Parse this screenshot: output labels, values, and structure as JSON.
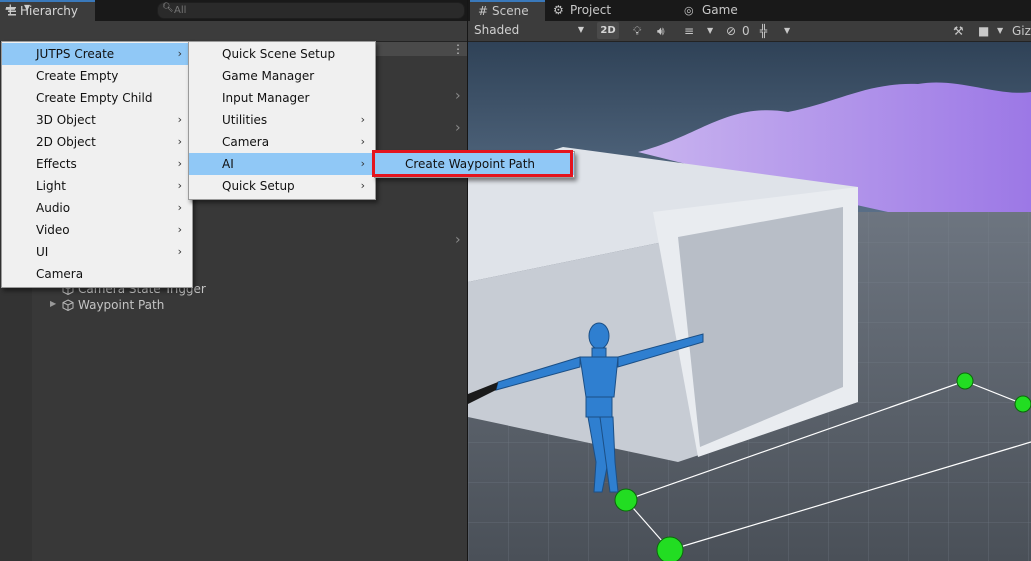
{
  "hierarchy": {
    "tab_title": "Hierarchy",
    "add_label": "+",
    "search_placeholder": "All",
    "tree_items": [
      {
        "label": "Camera State Trigger",
        "expandable": false
      },
      {
        "label": "Waypoint Path",
        "expandable": true
      }
    ]
  },
  "scene": {
    "tabs": [
      "Scene",
      "Project Settings",
      "Game"
    ],
    "shading_mode": "Shaded",
    "toggle_2d": "2D",
    "hidden_count": "0",
    "gizmos_label": "Giz"
  },
  "menus": {
    "main": [
      {
        "label": "JUTPS Create",
        "submenu": true,
        "highlighted": true
      },
      {
        "label": "Create Empty",
        "submenu": false
      },
      {
        "label": "Create Empty Child",
        "submenu": false
      },
      {
        "label": "3D Object",
        "submenu": true
      },
      {
        "label": "2D Object",
        "submenu": true
      },
      {
        "label": "Effects",
        "submenu": true
      },
      {
        "label": "Light",
        "submenu": true
      },
      {
        "label": "Audio",
        "submenu": true
      },
      {
        "label": "Video",
        "submenu": true
      },
      {
        "label": "UI",
        "submenu": true
      },
      {
        "label": "Camera",
        "submenu": false
      }
    ],
    "jutps": [
      {
        "label": "Quick Scene Setup",
        "submenu": false
      },
      {
        "label": "Game Manager",
        "submenu": false
      },
      {
        "label": "Input Manager",
        "submenu": false
      },
      {
        "label": "Utilities",
        "submenu": true
      },
      {
        "label": "Camera",
        "submenu": true
      },
      {
        "label": "AI",
        "submenu": true,
        "highlighted": true
      },
      {
        "label": "Quick Setup",
        "submenu": true
      }
    ],
    "ai": [
      {
        "label": "Create Waypoint Path",
        "submenu": false,
        "highlighted": true
      }
    ]
  },
  "colors": {
    "accent_tab": "#3a79bb",
    "menu_highlight": "#90c8f6",
    "callout_border": "#e4141e",
    "waypoint_gizmo": "#22dd22"
  }
}
